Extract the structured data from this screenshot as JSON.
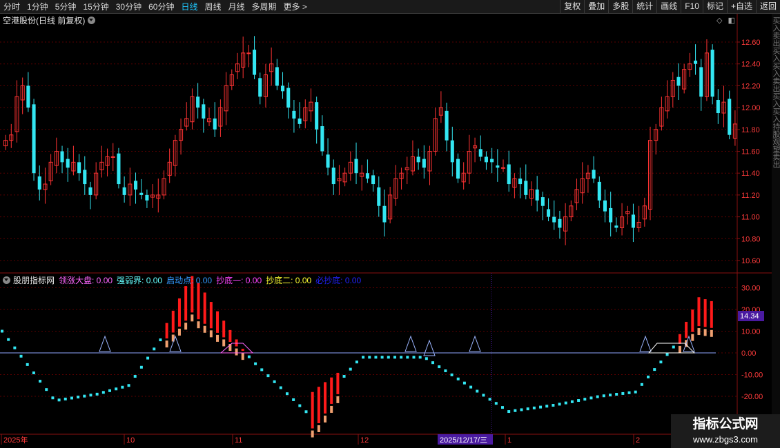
{
  "toolbar": {
    "periods": [
      "分时",
      "1分钟",
      "5分钟",
      "15分钟",
      "30分钟",
      "60分钟",
      "日线",
      "周线",
      "月线",
      "多周期",
      "更多 >"
    ],
    "active_period": "日线",
    "right_buttons": [
      "复权",
      "叠加",
      "多股",
      "统计",
      "画线",
      "F10",
      "标记",
      "+自选",
      "返回"
    ]
  },
  "main_chart": {
    "title": "空港股份(日线 前复权)",
    "price_ticks": [
      "12.60",
      "12.40",
      "12.20",
      "12.00",
      "11.80",
      "11.60",
      "11.40",
      "11.20",
      "11.00",
      "10.80",
      "10.60"
    ]
  },
  "indicator": {
    "name": "股朋指标网",
    "fields": [
      {
        "label": "领涨大盘:",
        "value": "0.00",
        "color": "#ff66ff"
      },
      {
        "label": "强弱界:",
        "value": "0.00",
        "color": "#66ffff"
      },
      {
        "label": "启动点:",
        "value": "0.00",
        "color": "#3399ff"
      },
      {
        "label": "抄底一:",
        "value": "0.00",
        "color": "#ff44ff"
      },
      {
        "label": "抄底二:",
        "value": "0.00",
        "color": "#ffff33"
      },
      {
        "label": "必抄底:",
        "value": "0.00",
        "color": "#2222ff"
      }
    ],
    "ticks": [
      "30.00",
      "20.00",
      "10.00",
      "0.00",
      "-10.00",
      "-20.00"
    ],
    "current_value": "14.34"
  },
  "time_axis": {
    "labels": [
      "2025年",
      "10",
      "11",
      "12",
      "1",
      "2"
    ],
    "cursor_label": "2025/12/17/三"
  },
  "side_strip_text": "买入卖出买入买入卖出买入买入持股观望卖出",
  "watermark": {
    "title": "指标公式网",
    "url": "www.zbgs3.com"
  },
  "colors": {
    "up": "#ff3333",
    "down": "#33e6f2",
    "grid": "#5a0000",
    "axis": "#8a1010",
    "tick_text": "#ff3b3b",
    "active": "#1ec8ff"
  }
}
